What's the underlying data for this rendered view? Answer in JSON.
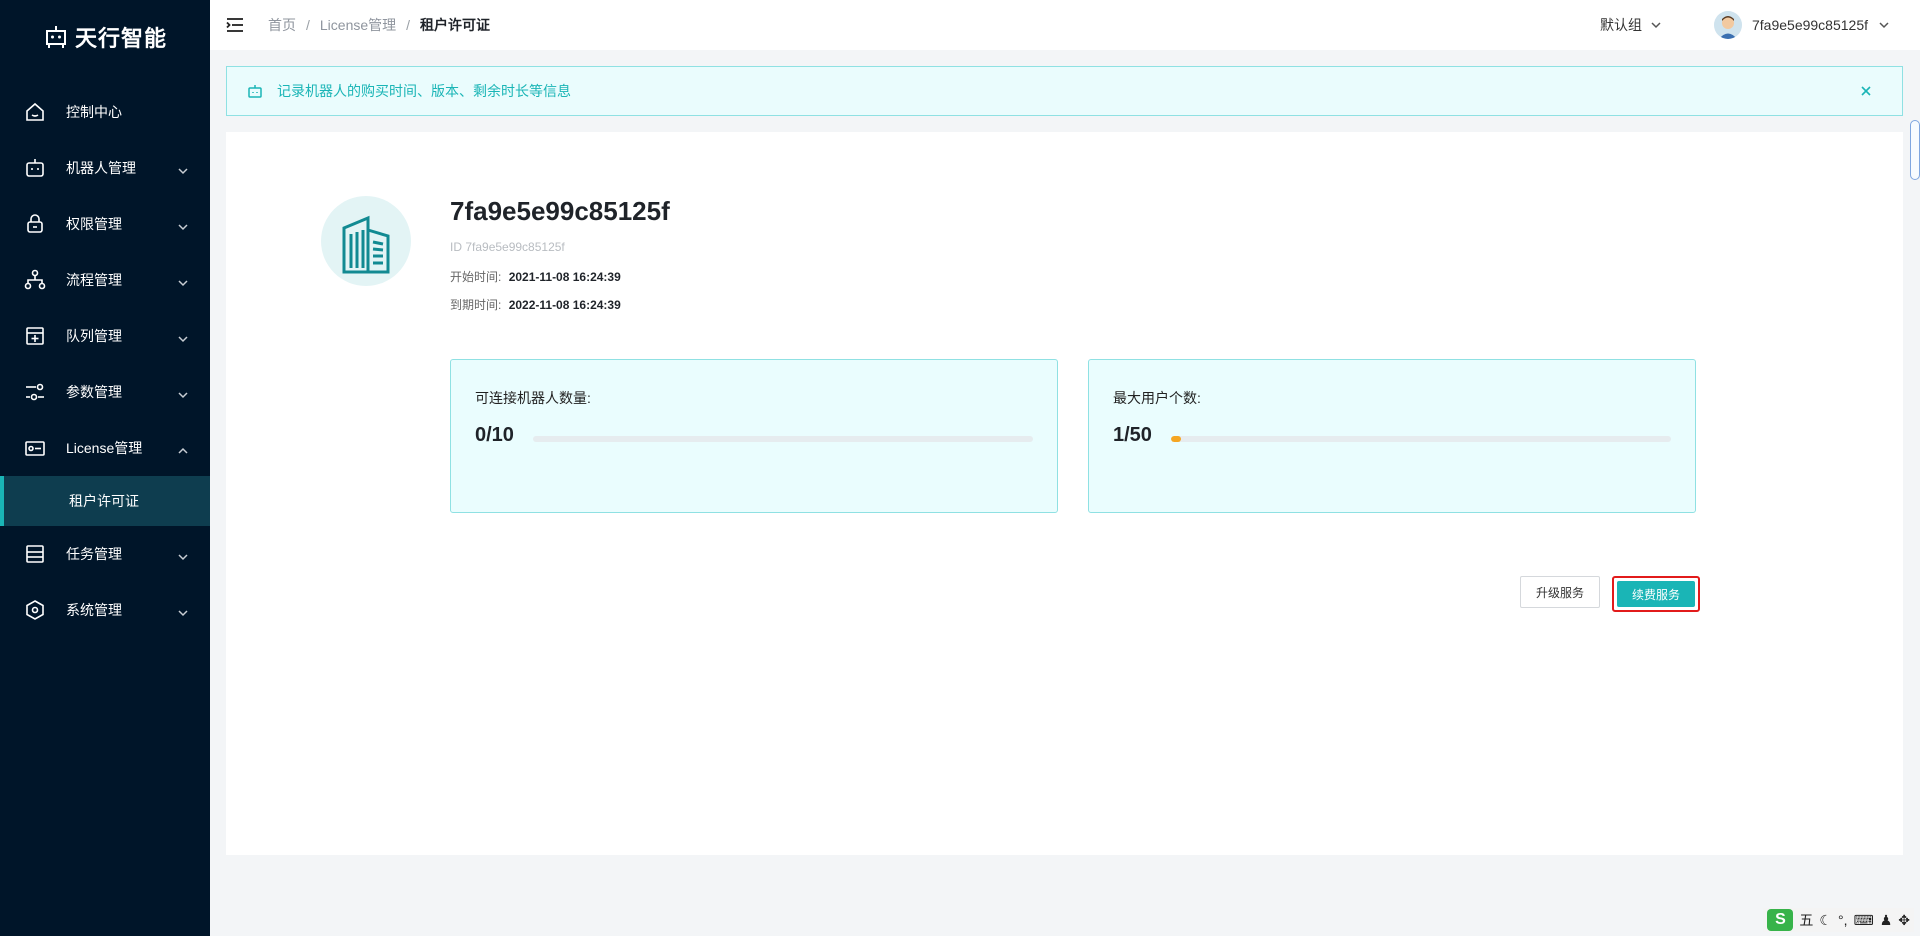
{
  "brand": {
    "name": "天行智能"
  },
  "sidebar": {
    "items": [
      {
        "label": "控制中心",
        "icon": "home-icon",
        "has_children": false
      },
      {
        "label": "机器人管理",
        "icon": "robot-icon",
        "has_children": true
      },
      {
        "label": "权限管理",
        "icon": "lock-icon",
        "has_children": true
      },
      {
        "label": "流程管理",
        "icon": "flow-icon",
        "has_children": true
      },
      {
        "label": "队列管理",
        "icon": "queue-icon",
        "has_children": true
      },
      {
        "label": "参数管理",
        "icon": "sliders-icon",
        "has_children": true
      },
      {
        "label": "License管理",
        "icon": "license-icon",
        "has_children": true,
        "expanded": true
      },
      {
        "label": "租户许可证",
        "submenu": true,
        "active": true
      },
      {
        "label": "任务管理",
        "icon": "task-icon",
        "has_children": true
      },
      {
        "label": "系统管理",
        "icon": "settings-icon",
        "has_children": true
      }
    ]
  },
  "header": {
    "breadcrumb": [
      "首页",
      "License管理",
      "租户许可证"
    ],
    "separator": "/",
    "group": "默认组",
    "username": "7fa9e5e99c85125f"
  },
  "alert": {
    "text": "记录机器人的购买时间、版本、剩余时长等信息"
  },
  "tenant": {
    "name": "7fa9e5e99c85125f",
    "id_text": "ID 7fa9e5e99c85125f",
    "start_label": "开始时间:",
    "start_value": "2021-11-08 16:24:39",
    "end_label": "到期时间:",
    "end_value": "2022-11-08 16:24:39"
  },
  "stats": [
    {
      "label": "可连接机器人数量:",
      "value": "0/10",
      "used": 0,
      "total": 10
    },
    {
      "label": "最大用户个数:",
      "value": "1/50",
      "used": 1,
      "total": 50
    }
  ],
  "buttons": {
    "upgrade": "升级服务",
    "renew": "续费服务"
  },
  "colors": {
    "primary": "#1ab5b6",
    "sidebar_bg": "#001529",
    "progress": "#f5a623",
    "highlight_border": "#e21b1b"
  },
  "ime": {
    "mode": "五"
  }
}
